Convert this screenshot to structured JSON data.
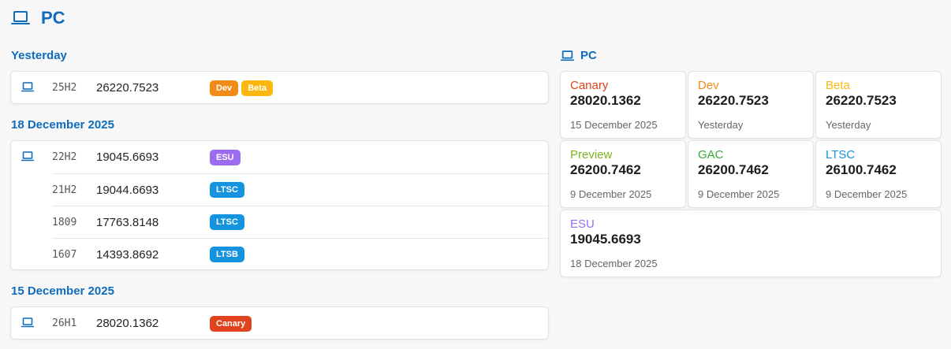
{
  "page": {
    "title": "PC",
    "icon": "laptop-icon"
  },
  "colors": {
    "accent": "#0f6cbd",
    "canary": "#e0431e",
    "dev": "#f28a17",
    "beta": "#fbb710",
    "preview": "#7ab51d",
    "gac": "#3aa83a",
    "ltsc": "#1493df",
    "ltsb": "#1493df",
    "esu": "#9b6cf0"
  },
  "timeline": [
    {
      "date": "Yesterday",
      "rows": [
        {
          "version": "25H2",
          "build": "26220.7523",
          "tags": [
            "Dev",
            "Beta"
          ]
        }
      ]
    },
    {
      "date": "18 December 2025",
      "rows": [
        {
          "version": "22H2",
          "build": "19045.6693",
          "tags": [
            "ESU"
          ]
        },
        {
          "version": "21H2",
          "build": "19044.6693",
          "tags": [
            "LTSC"
          ]
        },
        {
          "version": "1809",
          "build": "17763.8148",
          "tags": [
            "LTSC"
          ]
        },
        {
          "version": "1607",
          "build": "14393.8692",
          "tags": [
            "LTSB"
          ]
        }
      ]
    },
    {
      "date": "15 December 2025",
      "rows": [
        {
          "version": "26H1",
          "build": "28020.1362",
          "tags": [
            "Canary"
          ]
        }
      ]
    }
  ],
  "summary": {
    "title": "PC",
    "channels": [
      {
        "name": "Canary",
        "build": "28020.1362",
        "date": "15 December 2025"
      },
      {
        "name": "Dev",
        "build": "26220.7523",
        "date": "Yesterday"
      },
      {
        "name": "Beta",
        "build": "26220.7523",
        "date": "Yesterday"
      },
      {
        "name": "Preview",
        "build": "26200.7462",
        "date": "9 December 2025"
      },
      {
        "name": "GAC",
        "build": "26200.7462",
        "date": "9 December 2025"
      },
      {
        "name": "LTSC",
        "build": "26100.7462",
        "date": "9 December 2025"
      },
      {
        "name": "ESU",
        "build": "19045.6693",
        "date": "18 December 2025"
      }
    ]
  }
}
